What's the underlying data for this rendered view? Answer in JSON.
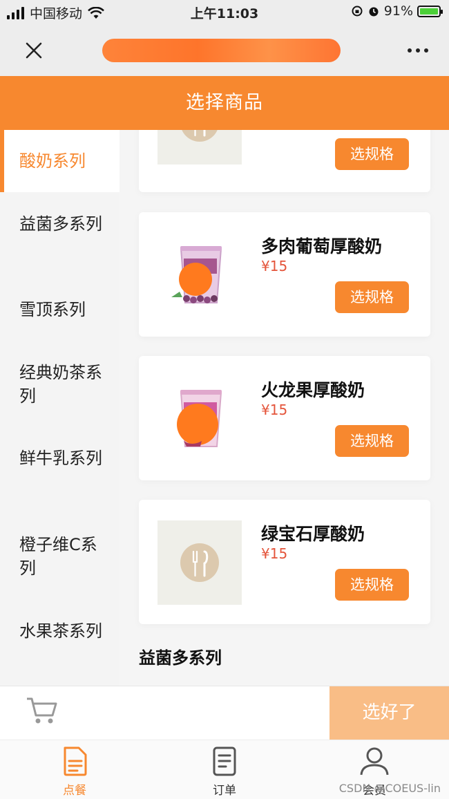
{
  "status_bar": {
    "carrier": "中国移动",
    "time": "上午11:03",
    "battery": "91%"
  },
  "header": {
    "title": "选择商品"
  },
  "sidebar": {
    "items": [
      {
        "label": "酸奶系列",
        "active": true
      },
      {
        "label": "益菌多系列"
      },
      {
        "label": "雪顶系列"
      },
      {
        "label": "经典奶茶系列"
      },
      {
        "label": "鲜牛乳系列"
      },
      {
        "label": "橙子维C系列"
      },
      {
        "label": "水果茶系列"
      }
    ]
  },
  "products": [
    {
      "name": "",
      "price": "",
      "button": "选规格"
    },
    {
      "name": "多肉葡萄厚酸奶",
      "price": "¥15",
      "button": "选规格"
    },
    {
      "name": "火龙果厚酸奶",
      "price": "¥15",
      "button": "选规格"
    },
    {
      "name": "绿宝石厚酸奶",
      "price": "¥15",
      "button": "选规格"
    }
  ],
  "section": {
    "next_title": "益菌多系列"
  },
  "cart_bar": {
    "done_label": "选好了"
  },
  "tab_bar": {
    "items": [
      {
        "label": "点餐",
        "active": true
      },
      {
        "label": "订单"
      },
      {
        "label": "会员"
      }
    ]
  },
  "watermark": "CSDN @COEUS-lin",
  "colors": {
    "accent": "#f7882f",
    "price": "#e4543a",
    "done_button": "#f9bd86"
  }
}
